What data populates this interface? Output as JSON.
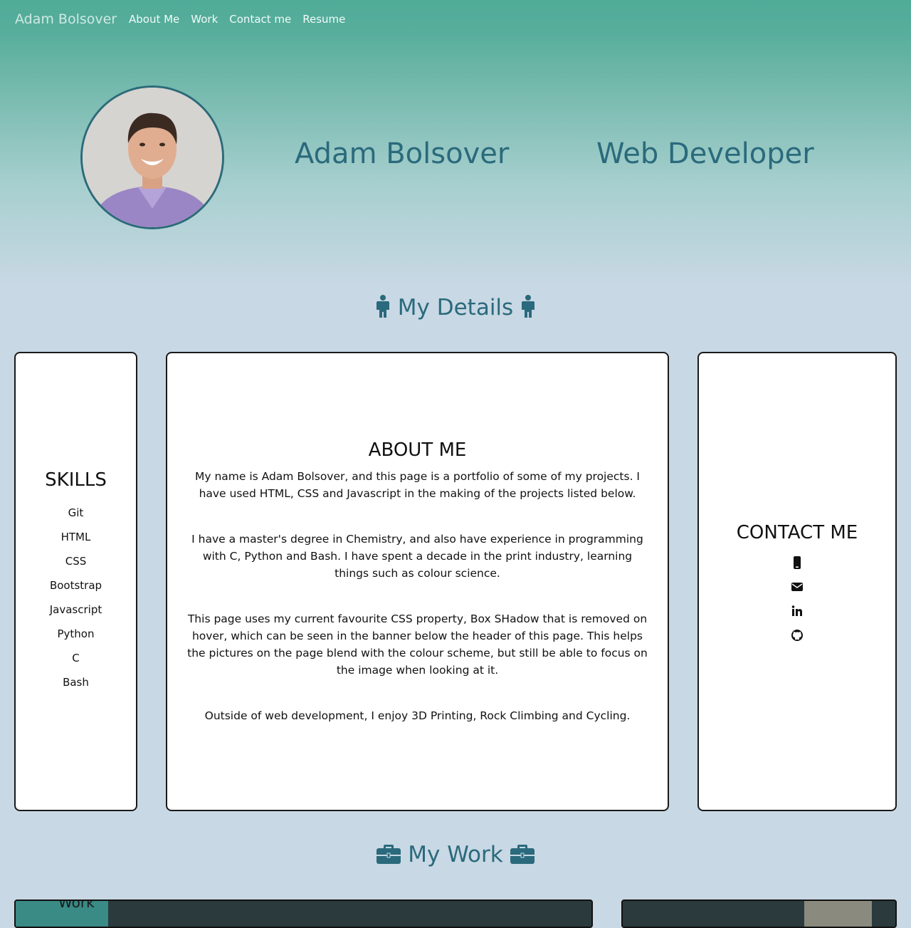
{
  "nav": {
    "brand": "Adam Bolsover",
    "links": [
      "About Me",
      "Work",
      "Contact me",
      "Resume"
    ]
  },
  "hero": {
    "name": "Adam Bolsover",
    "role": "Web Developer",
    "avatar_icon": "profile-photo"
  },
  "details": {
    "title": "My Details",
    "icon": "male-icon"
  },
  "skills": {
    "title": "SKILLS",
    "items": [
      "Git",
      "HTML",
      "CSS",
      "Bootstrap",
      "Javascript",
      "Python",
      "C",
      "Bash"
    ]
  },
  "about": {
    "title": "ABOUT ME",
    "paragraphs": [
      "My name is Adam Bolsover, and this page is a portfolio of some of my projects. I have used HTML, CSS and Javascript in the making of the projects listed below.",
      "I have a master's degree in Chemistry, and also have experience in programming with C, Python and Bash. I have spent a decade in the print industry, learning things such as colour science.",
      "This page uses my current favourite CSS property, Box SHadow that is removed on hover, which can be seen in the banner below the header of this page. This helps the pictures on the page blend with the colour scheme, but still be able to focus on the image when looking at it.",
      "Outside of web development, I enjoy 3D Printing, Rock Climbing and Cycling."
    ]
  },
  "contact": {
    "title": "CONTACT ME",
    "icons": [
      "mobile-phone-icon",
      "envelope-icon",
      "linkedin-icon",
      "github-icon"
    ]
  },
  "work": {
    "title": "My Work",
    "icon": "briefcase-icon",
    "first_card_caption": "Work"
  },
  "colors": {
    "accent": "#2a6a7c",
    "nav_green": "#4fab97",
    "page_bg": "#c8d8e4"
  }
}
